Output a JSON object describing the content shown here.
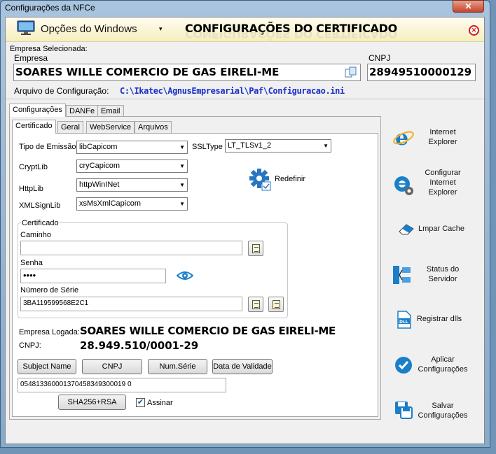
{
  "window": {
    "title": "Configurações da NFCe",
    "close_glyph": "✕"
  },
  "topbar": {
    "windows_options": "Opções do Windows",
    "header": "CONFIGURAÇÕES DO CERTIFICADO"
  },
  "company": {
    "section_label": "Empresa Selecionada:",
    "empresa_label": "Empresa",
    "empresa_value": "SOARES WILLE COMERCIO DE GAS EIRELI-ME",
    "cnpj_label": "CNPJ",
    "cnpj_value": "28949510000129",
    "config_file_label": "Arquivo de Configuração:",
    "config_file_path": "C:\\Ikatec\\AgnusEmpresarial\\Paf\\Configuracao.ini"
  },
  "outer_tabs": [
    "Configurações",
    "DANFe",
    "Email"
  ],
  "inner_tabs": [
    "Certificado",
    "Geral",
    "WebService",
    "Arquivos"
  ],
  "certificado": {
    "tipo_emissao_label": "Tipo de Emissão",
    "tipo_emissao_value": "libCapicom",
    "ssltype_label": "SSLType",
    "ssltype_value": "LT_TLSv1_2",
    "cryptlib_label": "CryptLib",
    "cryptlib_value": "cryCapicom",
    "httplib_label": "HttpLib",
    "httplib_value": "httpWinINet",
    "xmlsignlib_label": "XMLSignLib",
    "xmlsignlib_value": "xsMsXmlCapicom",
    "redefinir_label": "Redefinir",
    "group_label": "Certificado",
    "caminho_label": "Caminho",
    "caminho_value": "",
    "senha_label": "Senha",
    "senha_value": "••••",
    "numero_serie_label": "Número de Série",
    "numero_serie_value": "3BA119599568E2C1",
    "empresa_logada_label": "Empresa Logada:",
    "empresa_logada_value": "SOARES WILLE COMERCIO DE GAS EIRELI-ME",
    "cnpj_label": "CNPJ:",
    "cnpj_value": "28.949.510/0001-29",
    "buttons": [
      "Subject Name",
      "CNPJ",
      "Num.Série",
      "Data de Validade"
    ],
    "result_value": "054813360001370458349300019 0",
    "sha_button": "SHA256+RSA",
    "assinar_label": "Assinar",
    "assinar_checked": true
  },
  "side_actions": [
    {
      "label": "Internet Explorer",
      "icon": "internet-explorer-icon"
    },
    {
      "label": "Configurar Internet Explorer",
      "icon": "configure-ie-icon"
    },
    {
      "label": "Lmpar Cache",
      "icon": "eraser-icon"
    },
    {
      "label": "Status do Servidor",
      "icon": "server-status-icon"
    },
    {
      "label": "Registrar dlls",
      "icon": "dll-icon"
    },
    {
      "label": "Aplicar Configurações",
      "icon": "check-circle-icon"
    },
    {
      "label": "Salvar Configurações",
      "icon": "save-icon"
    }
  ],
  "colors": {
    "accent_blue": "#1a7fc9",
    "path_blue": "#1a2fc9",
    "close_red": "#d21c1c"
  }
}
